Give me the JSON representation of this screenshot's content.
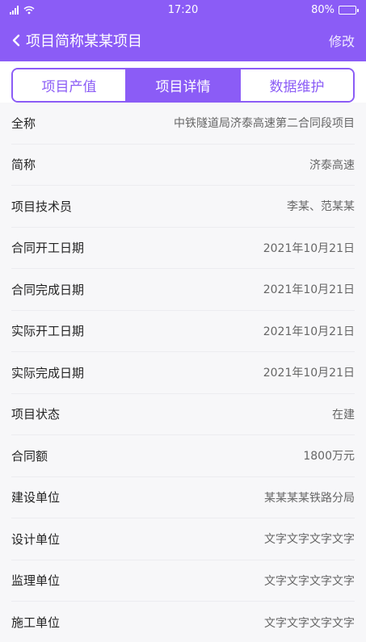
{
  "status_bar": {
    "time": "17:20",
    "battery": "80%",
    "battery_level": 0.8,
    "icons": [
      "signal-icon",
      "wifi-icon",
      "battery-icon"
    ]
  },
  "nav": {
    "back_icon": "chevron-left-icon",
    "title": "项目简称某某项目",
    "edit_label": "修改"
  },
  "tabs": [
    {
      "label": "项目产值",
      "active": false
    },
    {
      "label": "项目详情",
      "active": true
    },
    {
      "label": "数据维护",
      "active": false
    }
  ],
  "details": [
    {
      "label": "全称",
      "value": "中铁隧道局济泰高速第二合同段项目"
    },
    {
      "label": "简称",
      "value": "济泰高速"
    },
    {
      "label": "项目技术员",
      "value": "李某、范某某"
    },
    {
      "label": "合同开工日期",
      "value": "2021年10月21日"
    },
    {
      "label": "合同完成日期",
      "value": "2021年10月21日"
    },
    {
      "label": "实际开工日期",
      "value": "2021年10月21日"
    },
    {
      "label": "实际完成日期",
      "value": "2021年10月21日"
    },
    {
      "label": "项目状态",
      "value": "在建"
    },
    {
      "label": "合同额",
      "value": "1800万元"
    },
    {
      "label": "建设单位",
      "value": "某某某某铁路分局"
    },
    {
      "label": "设计单位",
      "value": "文字文字文字文字"
    },
    {
      "label": "监理单位",
      "value": "文字文字文字文字"
    },
    {
      "label": "施工单位",
      "value": "文字文字文字文字"
    }
  ],
  "colors": {
    "primary": "#8b5cf6",
    "background": "#f7f7f9",
    "label_text": "#222222",
    "value_text": "#666666"
  }
}
